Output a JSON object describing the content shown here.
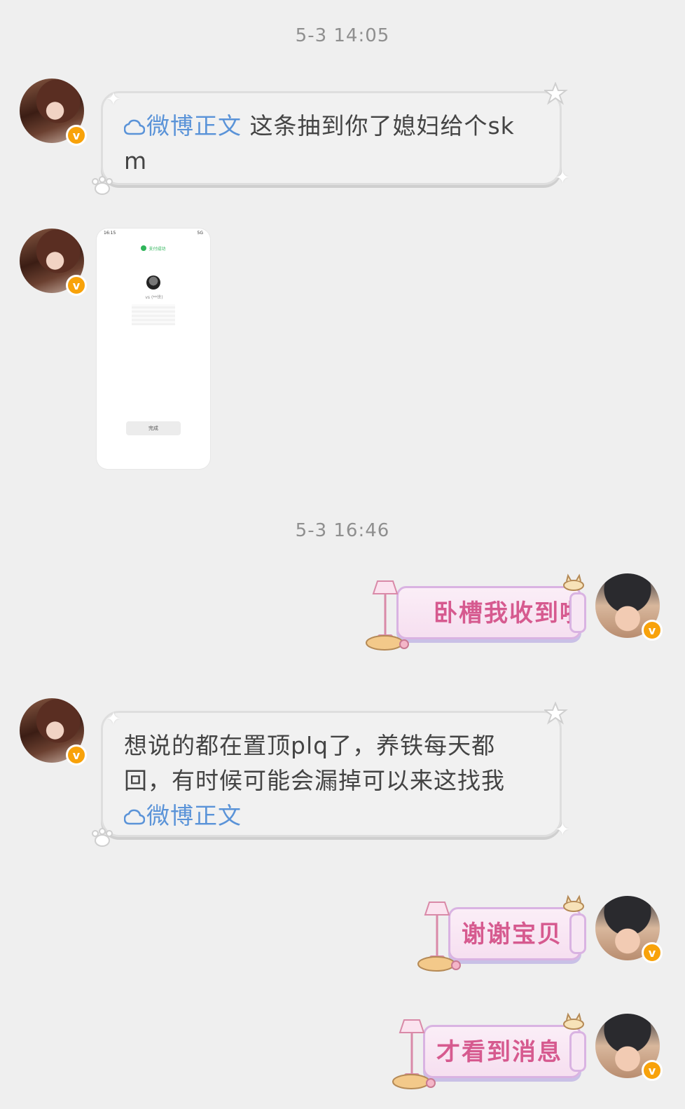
{
  "timestamps": [
    "5-3 14:05",
    "5-3 16:46"
  ],
  "messages": {
    "m1": {
      "link_text": "微博正文",
      "text_line1": " 这条抽到你了媳妇给个sk",
      "text_line2": "m",
      "link_icon": "cloud-icon"
    },
    "m2": {
      "image_status_time": "16:15",
      "image_status_right": "5G",
      "image_success_label": "支付成功",
      "image_name": "vs (**世)",
      "image_button": "完成"
    },
    "m3": {
      "text": "卧槽我收到啦"
    },
    "m4": {
      "line1": "想说的都在置顶plq了，养铁每天都",
      "line2": "回，有时候可能会漏掉可以来这找我",
      "link_text": "微博正文",
      "link_icon": "cloud-icon"
    },
    "m5": {
      "text": "谢谢宝贝"
    },
    "m6": {
      "text": "才看到消息"
    }
  },
  "badge": {
    "label": "v",
    "color": "#f8a20a"
  },
  "colors": {
    "link": "#5a93d8",
    "pink_text": "#d65a8f",
    "background": "#efefef"
  }
}
